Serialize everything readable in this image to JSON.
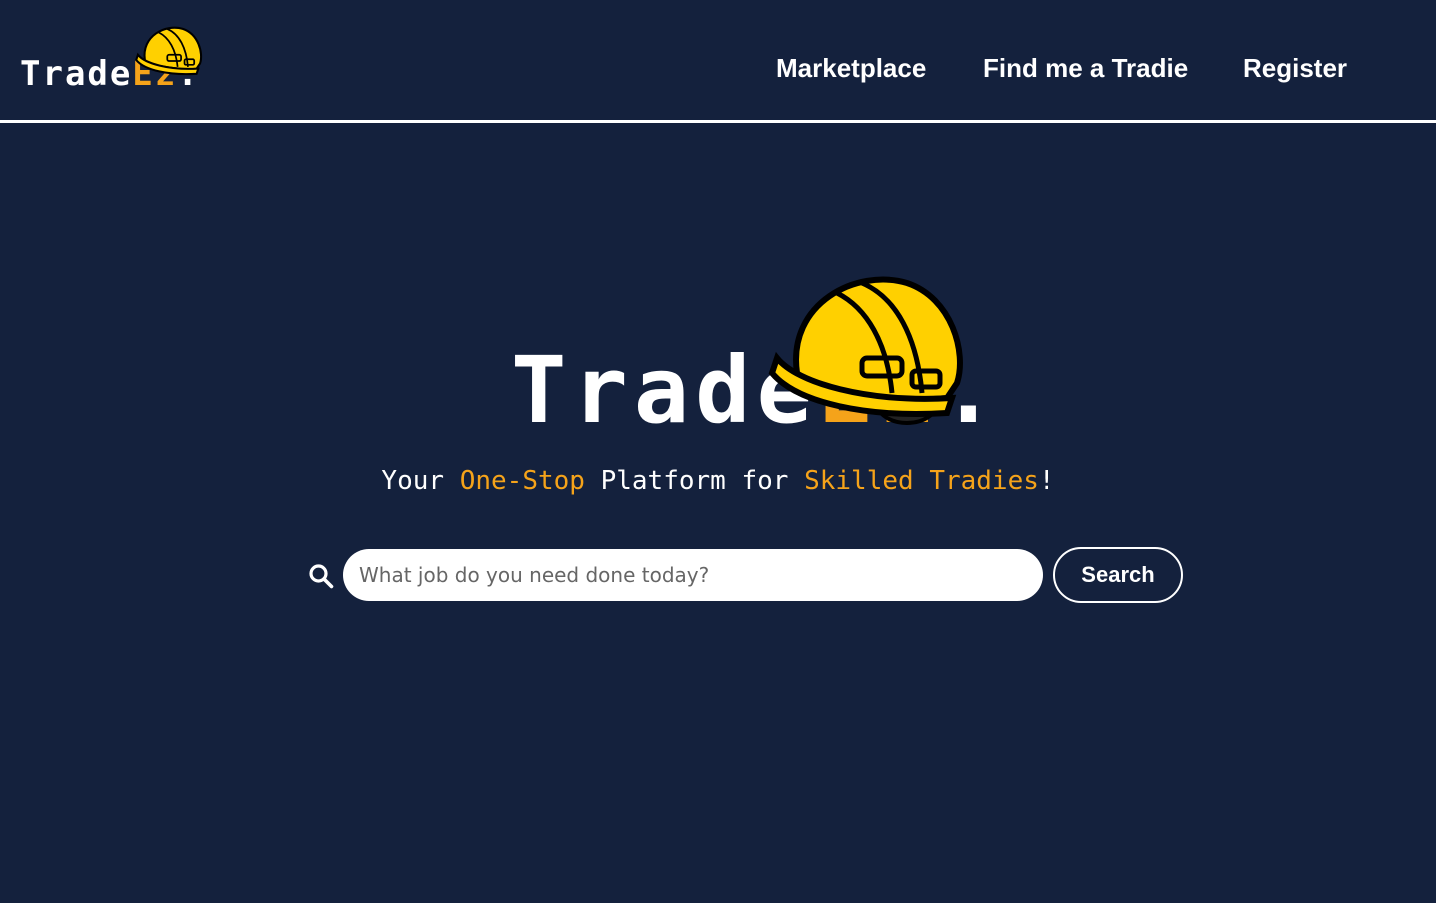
{
  "brand": {
    "name_main": "Trade",
    "name_accent": "Ez",
    "name_dot": ".",
    "accent_color": "#f5a31a",
    "helmet_color": "#ffd000",
    "background_color": "#14213d"
  },
  "header": {
    "logo_icon": "hard-hat-icon",
    "nav": [
      {
        "label": "Marketplace"
      },
      {
        "label": "Find me a Tradie"
      },
      {
        "label": "Register"
      }
    ]
  },
  "hero": {
    "tagline": {
      "part1": "Your ",
      "highlight1": "One-Stop",
      "part2": " Platform for ",
      "highlight2": "Skilled Tradies",
      "part3": "!"
    },
    "search": {
      "icon": "search-icon",
      "placeholder": "What job do you need done today?",
      "value": "",
      "button_label": "Search"
    }
  }
}
